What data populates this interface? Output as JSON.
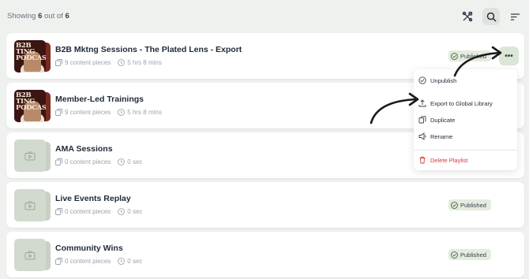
{
  "header": {
    "showing_prefix": "Showing",
    "showing_count": "6",
    "showing_middle": "out of",
    "showing_total": "6"
  },
  "toolbar": {
    "icons": [
      "tools-icon",
      "search-icon",
      "sort-icon"
    ]
  },
  "playlists": [
    {
      "title": "B2B Mktng Sessions - The Plated Lens - Export",
      "pieces": "9 content pieces",
      "duration": "5 hrs 8 mins",
      "status": "Published",
      "thumbnail": "podcast",
      "thumbnail_text": "B2B TING PODCAS"
    },
    {
      "title": "Member-Led Trainings",
      "pieces": "9 content pieces",
      "duration": "5 hrs 8 mins",
      "status": "",
      "thumbnail": "podcast",
      "thumbnail_text": "B2B TING PODCAS"
    },
    {
      "title": "AMA Sessions",
      "pieces": "0 content pieces",
      "duration": "0 sec",
      "status": "",
      "thumbnail": "placeholder"
    },
    {
      "title": "Live Events Replay",
      "pieces": "0 content pieces",
      "duration": "0 sec",
      "status": "Published",
      "thumbnail": "placeholder"
    },
    {
      "title": "Community Wins",
      "pieces": "0 content pieces",
      "duration": "0 sec",
      "status": "Published",
      "thumbnail": "placeholder"
    }
  ],
  "more_button": {
    "label": "•••"
  },
  "menu": {
    "items": [
      {
        "label": "Unpublish",
        "icon": "unpublish-icon"
      },
      {
        "label": "Export to Global Library",
        "icon": "export-icon"
      },
      {
        "label": "Duplicate",
        "icon": "duplicate-icon"
      },
      {
        "label": "Rename",
        "icon": "rename-icon"
      },
      {
        "label": "Delete Playlist",
        "icon": "trash-icon"
      }
    ]
  },
  "colors": {
    "background": "#eef1ee",
    "published_badge": "#e4ebdf",
    "published_check": "#3f6b3a",
    "danger": "#d23b3b"
  }
}
